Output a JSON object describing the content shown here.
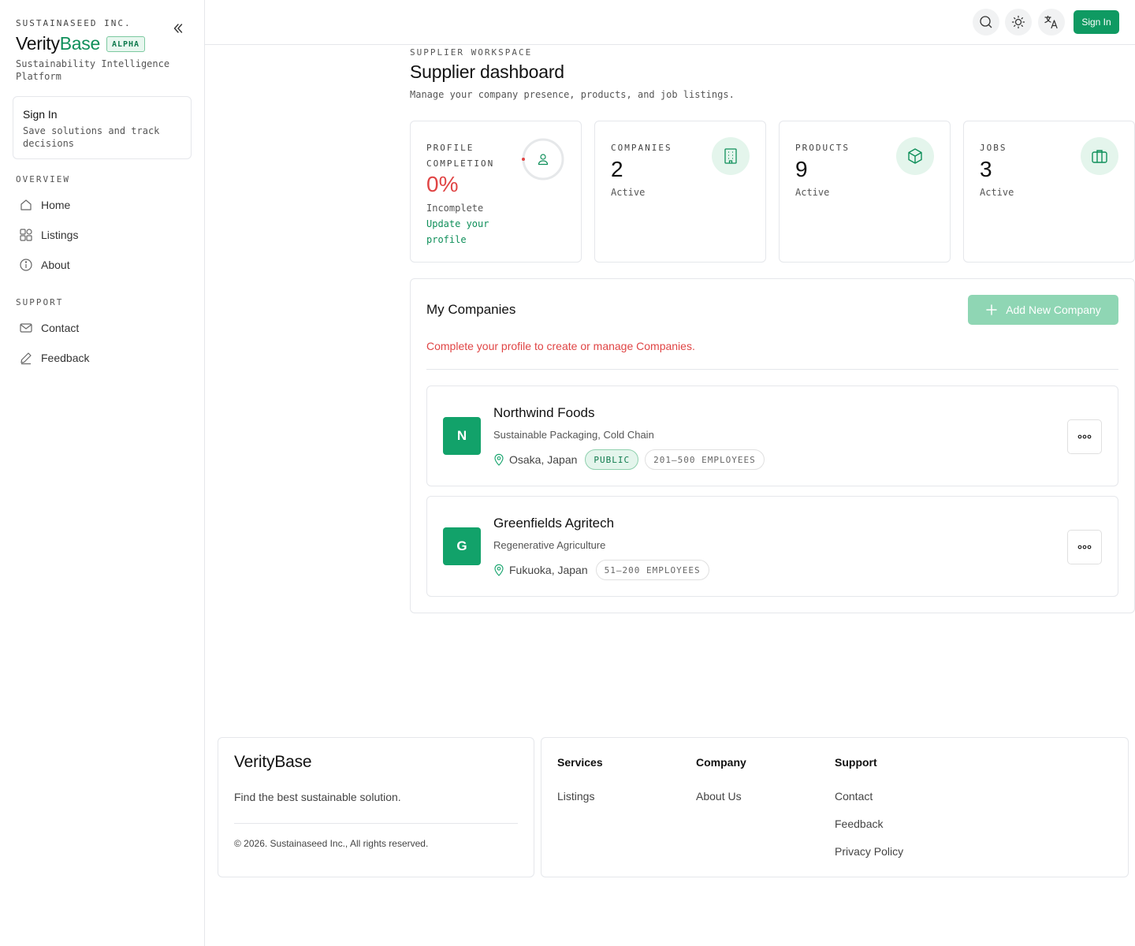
{
  "sidebar": {
    "org": "SUSTAINASEED INC.",
    "brand_main": "Verity",
    "brand_accent": "Base",
    "badge": "ALPHA",
    "tagline": "Sustainability Intelligence Platform",
    "signin_card": {
      "title": "Sign In",
      "desc": "Save solutions and track decisions"
    },
    "overview_label": "OVERVIEW",
    "overview_items": [
      {
        "label": "Home",
        "icon": "home-icon"
      },
      {
        "label": "Listings",
        "icon": "grid-icon"
      },
      {
        "label": "About",
        "icon": "info-icon"
      }
    ],
    "support_label": "SUPPORT",
    "support_items": [
      {
        "label": "Contact",
        "icon": "mail-icon"
      },
      {
        "label": "Feedback",
        "icon": "pencil-icon"
      }
    ]
  },
  "header": {
    "signin_label": "Sign In",
    "icons": [
      "search-icon",
      "sun-icon",
      "translate-icon"
    ]
  },
  "main": {
    "eyebrow": "SUPPLIER WORKSPACE",
    "title": "Supplier dashboard",
    "subtitle": "Manage your company presence, products, and job listings.",
    "stats": {
      "profile": {
        "label": "PROFILE COMPLETION",
        "value": "0%",
        "status": "Incomplete",
        "link": "Update your profile",
        "progress": 0
      },
      "companies": {
        "label": "COMPANIES",
        "value": "2",
        "sub": "Active"
      },
      "products": {
        "label": "PRODUCTS",
        "value": "9",
        "sub": "Active"
      },
      "jobs": {
        "label": "JOBS",
        "value": "3",
        "sub": "Active"
      }
    },
    "companies_section": {
      "title": "My Companies",
      "add_label": "Add New Company",
      "warning": "Complete your profile to create or manage Companies.",
      "items": [
        {
          "initial": "N",
          "name": "Northwind Foods",
          "categories": "Sustainable Packaging, Cold Chain",
          "location": "Osaka, Japan",
          "visibility": "PUBLIC",
          "employees": "201–500 EMPLOYEES"
        },
        {
          "initial": "G",
          "name": "Greenfields Agritech",
          "categories": "Regenerative Agriculture",
          "location": "Fukuoka, Japan",
          "employees": "51–200 EMPLOYEES"
        }
      ]
    }
  },
  "footer": {
    "brand": "VerityBase",
    "tagline": "Find the best sustainable solution.",
    "copyright": "© 2026. Sustainaseed Inc., All rights reserved.",
    "columns": [
      {
        "heading": "Services",
        "links": [
          "Listings"
        ]
      },
      {
        "heading": "Company",
        "links": [
          "About Us"
        ]
      },
      {
        "heading": "Support",
        "links": [
          "Contact",
          "Feedback",
          "Privacy Policy"
        ]
      }
    ]
  },
  "colors": {
    "accent": "#0f9a62",
    "danger": "#e04545",
    "accent_soft": "#e4f5ec"
  }
}
